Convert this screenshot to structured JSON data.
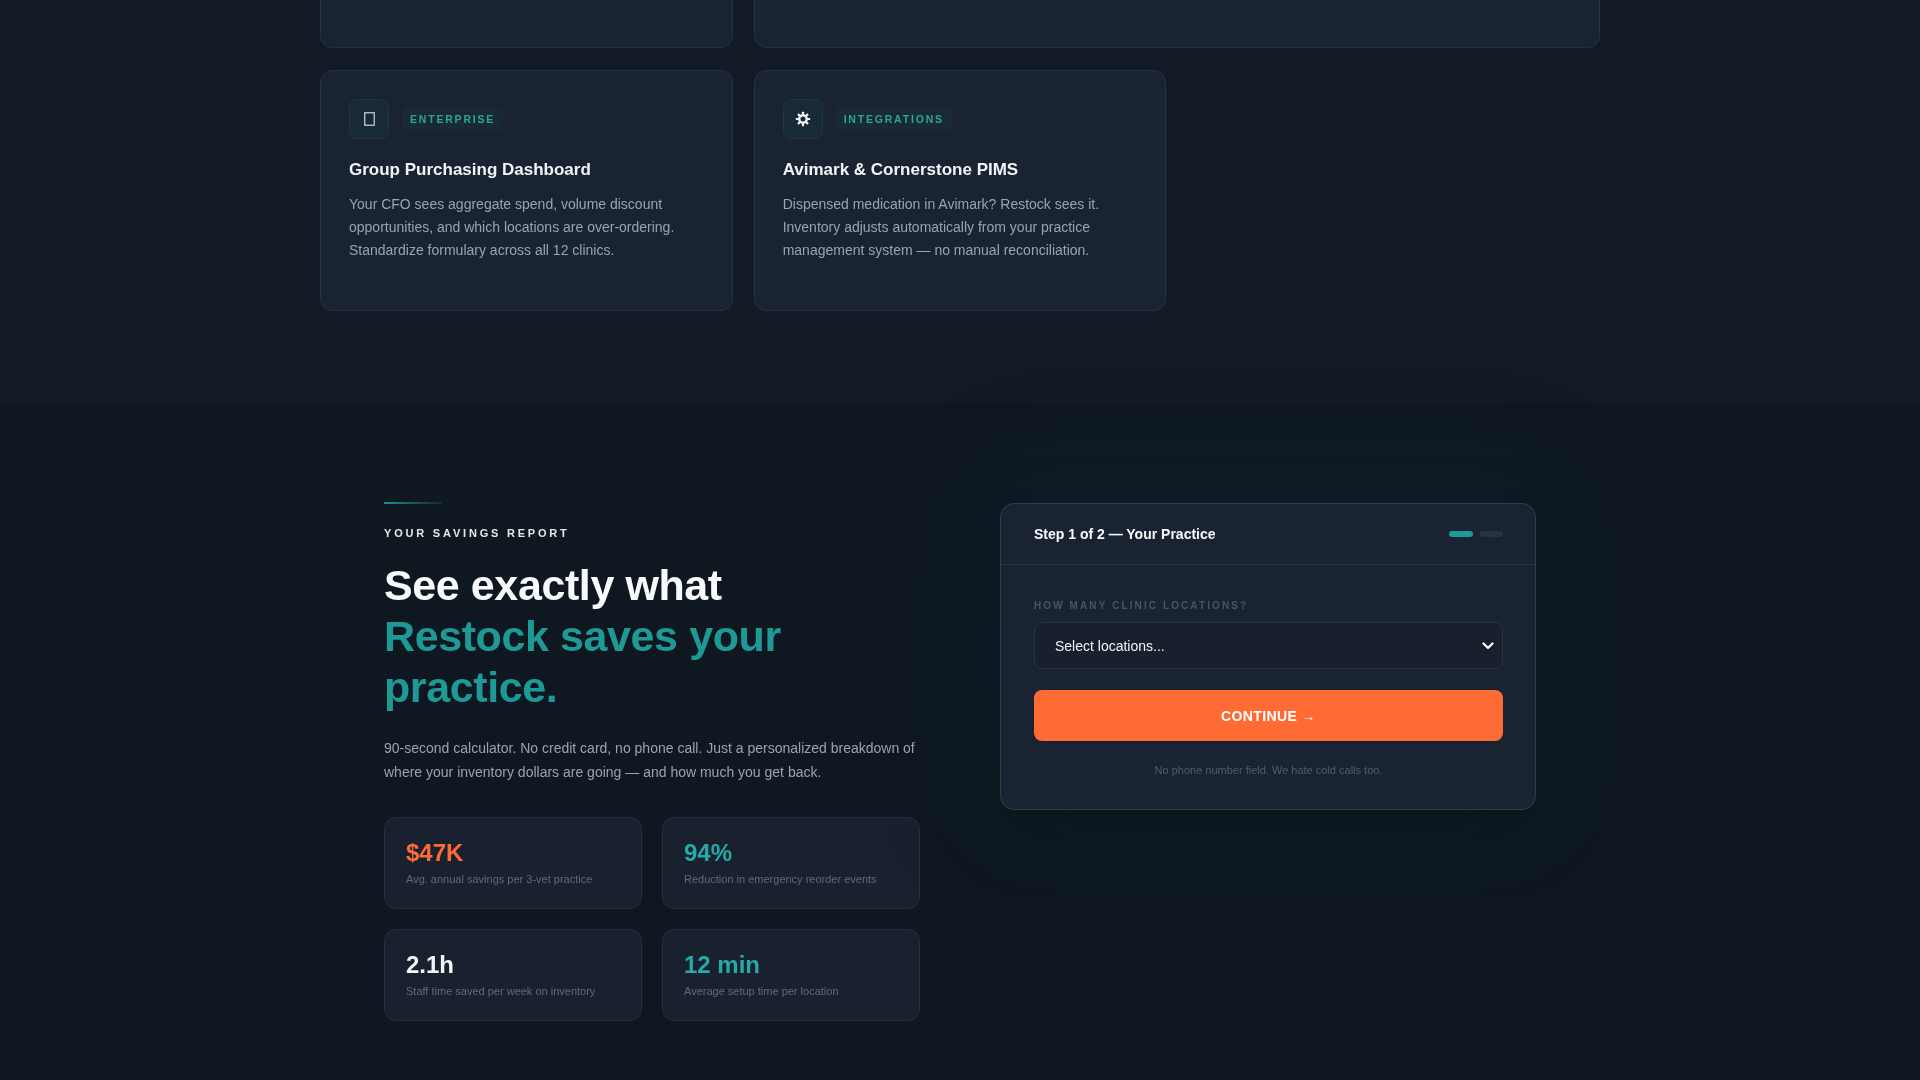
{
  "feature_cards": [
    {
      "tag": "ENTERPRISE",
      "title": "Group Purchasing Dashboard",
      "description": "Your CFO sees aggregate spend, volume discount opportunities, and which locations are over-ordering. Standardize formulary across all 12 clinics."
    },
    {
      "tag": "INTEGRATIONS",
      "title": "Avimark & Cornerstone PIMS",
      "description": "Dispensed medication in Avimark? Restock sees it. Inventory adjusts automatically from your practice management system — no manual reconciliation."
    }
  ],
  "savings": {
    "eyebrow": "YOUR SAVINGS REPORT",
    "headline": "See exactly what",
    "headline_accent": "Restock saves your practice.",
    "description": "90-second calculator. No credit card, no phone call. Just a personalized breakdown of where your inventory dollars are going — and how much you get back.",
    "stats": [
      {
        "value": "$47K",
        "label": "Avg. annual savings per 3-vet practice",
        "color": "#ff6b35"
      },
      {
        "value": "94%",
        "label": "Reduction in emergency reorder events",
        "color": "#26aaa8"
      },
      {
        "value": "2.1h",
        "label": "Staff time saved per week on inventory",
        "color": "#f3f4f6"
      },
      {
        "value": "12 min",
        "label": "Average setup time per location",
        "color": "#26aaa8"
      }
    ]
  },
  "calculator": {
    "title": "Step 1 of 2 — Your Practice",
    "steps": [
      {
        "active": true
      },
      {
        "active": false
      }
    ],
    "field": {
      "label": "HOW MANY CLINIC LOCATIONS?",
      "placeholder": "Select locations..."
    },
    "button": "CONTINUE →",
    "note": "No phone number field. We hate cold calls too."
  }
}
